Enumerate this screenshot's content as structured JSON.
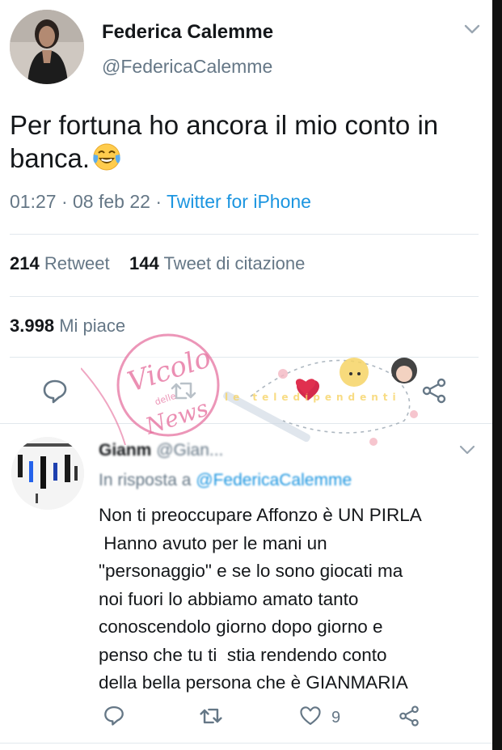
{
  "tweet": {
    "author_name": "Federica Calemme",
    "author_handle": "@FedericaCalemme",
    "text": "Per fortuna ho ancora il mio conto in banca.",
    "emoji": "face-with-tears-of-joy",
    "time": "01:27",
    "date": "08 feb 22",
    "separator": "·",
    "source": "Twitter for iPhone",
    "retweets_count": "214",
    "retweets_label": "Retweet",
    "quotes_count": "144",
    "quotes_label": "Tweet di citazione",
    "likes_count": "3.998",
    "likes_label": "Mi piace"
  },
  "actions": [
    "reply-icon",
    "retweet-icon",
    "like-icon",
    "share-icon"
  ],
  "reply": {
    "author_name": "Gianm",
    "author_rest": "@Gian...",
    "replying_to_label": "In risposta a",
    "replying_to_handle": "@FedericaCalemme",
    "lines": [
      "Non ti preoccupare Affonzo è UN PIRLA",
      " Hanno avuto per le mani un",
      "\"personaggio\" e se lo sono giocati ma",
      "noi fuori lo abbiamo amato tanto",
      "conoscendolo giorno dopo giorno e",
      "penso che tu ti  stia rendendo conto",
      "della bella persona che è GIANMARIA"
    ],
    "like_count": "9"
  },
  "watermark": {
    "logo_text": "Vicolo delle News",
    "banner_text": "le teledipendenti"
  },
  "colors": {
    "text": "#14171a",
    "secondary": "#657786",
    "link": "#1b95e0",
    "watermark_pink": "#e46a9a"
  }
}
